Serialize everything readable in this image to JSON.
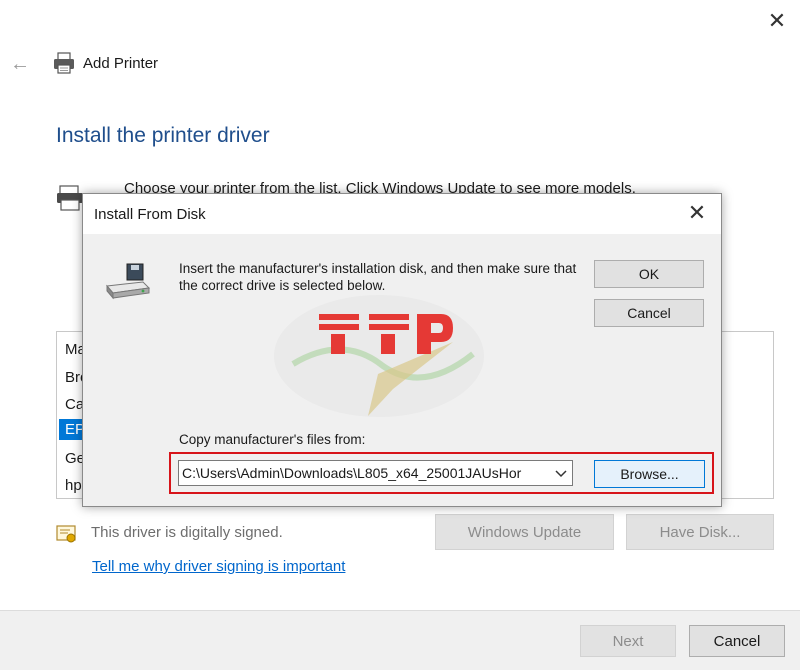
{
  "wizard": {
    "title": "Add Printer",
    "heading": "Install the printer driver",
    "intro": "Choose your printer from the list. Click Windows Update to see more models.",
    "list_items": [
      "Ma",
      "Bro",
      "Ca",
      "EP",
      "Ge",
      "hp"
    ],
    "selected_index": 3,
    "signed_text": "This driver is digitally signed.",
    "signing_link": "Tell me why driver signing is important",
    "windows_update_label": "Windows Update",
    "have_disk_label": "Have Disk...",
    "next_label": "Next",
    "cancel_label": "Cancel"
  },
  "dialog": {
    "title": "Install From Disk",
    "message": "Insert the manufacturer's installation disk, and then make sure that the correct drive is selected below.",
    "ok_label": "OK",
    "cancel_label": "Cancel",
    "copy_label": "Copy manufacturer's files from:",
    "path_value": "C:\\Users\\Admin\\Downloads\\L805_x64_25001JAUsHor",
    "browse_label": "Browse..."
  },
  "icons": {
    "back": "back-arrow-icon",
    "printer": "printer-icon",
    "disk": "disk-drive-icon",
    "certificate": "certificate-icon",
    "close": "close-icon",
    "dropdown": "chevron-down-icon"
  },
  "colors": {
    "heading": "#1f4e8c",
    "selection": "#0078d7",
    "link": "#0066cc",
    "highlight_border": "#d7141a"
  }
}
